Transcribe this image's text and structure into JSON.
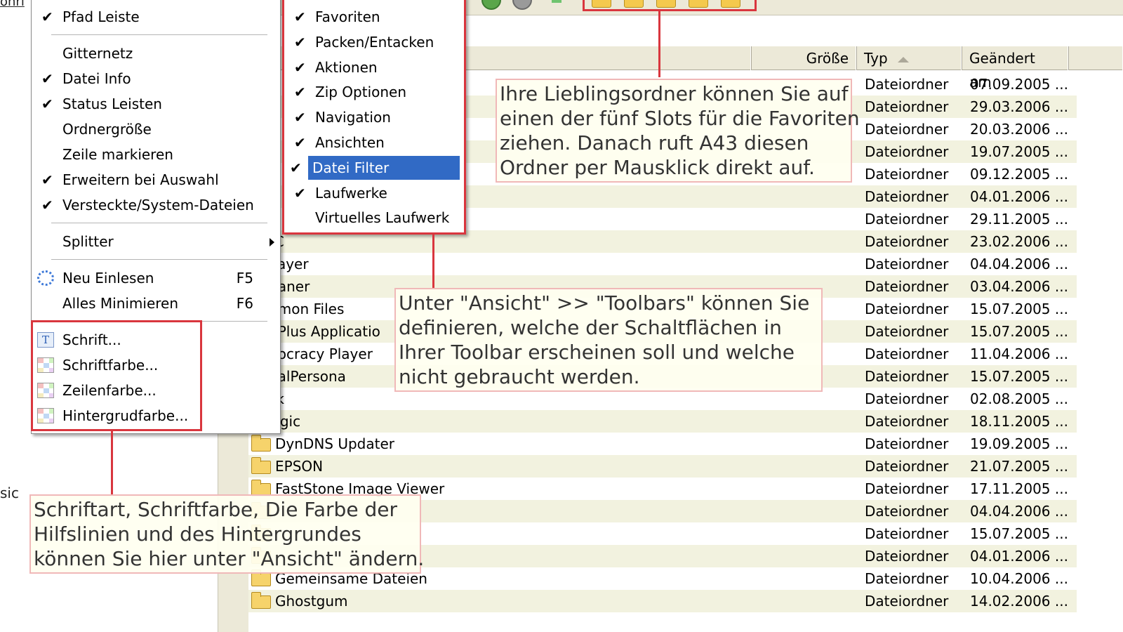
{
  "left_pane": {
    "scrap_top": "onri",
    "scrap_label": "sic"
  },
  "menu_main": {
    "items": [
      {
        "label": "Pfad Leiste",
        "checked": true
      },
      {
        "label": "Gitternetz",
        "checked": false
      },
      {
        "label": "Datei Info",
        "checked": true
      },
      {
        "label": "Status Leisten",
        "checked": true
      },
      {
        "label": "Ordnergröße",
        "checked": false
      },
      {
        "label": "Zeile markieren",
        "checked": false
      },
      {
        "label": "Erweitern bei Auswahl",
        "checked": true
      },
      {
        "label": "Versteckte/System-Dateien",
        "checked": true
      },
      {
        "label": "Splitter",
        "checked": false,
        "submenu": true
      },
      {
        "label": "Neu Einlesen",
        "shortcut": "F5",
        "icon": "refresh-icon"
      },
      {
        "label": "Alles Minimieren",
        "shortcut": "F6"
      },
      {
        "label": "Schrift...",
        "icon": "font-icon"
      },
      {
        "label": "Schriftfarbe...",
        "icon": "color-grid-icon"
      },
      {
        "label": "Zeilenfarbe...",
        "icon": "color-grid-icon"
      },
      {
        "label": "Hintergrudfarbe...",
        "icon": "color-grid-icon"
      }
    ]
  },
  "menu_toolbars": {
    "items": [
      {
        "label": "Favoriten",
        "checked": true
      },
      {
        "label": "Packen/Entacken",
        "checked": true
      },
      {
        "label": "Aktionen",
        "checked": true
      },
      {
        "label": "Zip Optionen",
        "checked": true
      },
      {
        "label": "Navigation",
        "checked": true
      },
      {
        "label": "Ansichten",
        "checked": true
      },
      {
        "label": "Datei Filter",
        "checked": true,
        "highlighted": true
      },
      {
        "label": "Laufwerke",
        "checked": true
      },
      {
        "label": "Virtuelles Laufwerk",
        "checked": false
      }
    ]
  },
  "list": {
    "headers": {
      "size": "Größe",
      "type": "Typ",
      "modified": "Geändert am"
    },
    "rows": [
      {
        "name": "",
        "type": "Dateiordner",
        "date": "07.09.2005 ..."
      },
      {
        "name": "",
        "type": "Dateiordner",
        "date": "29.03.2006 ..."
      },
      {
        "name": "",
        "type": "Dateiordner",
        "date": "20.03.2006 ..."
      },
      {
        "name": "",
        "type": "Dateiordner",
        "date": "19.07.2005 ..."
      },
      {
        "name": "",
        "type": "Dateiordner",
        "date": "09.12.2005 ..."
      },
      {
        "name": "",
        "type": "Dateiordner",
        "date": "04.01.2006 ..."
      },
      {
        "name": "",
        "type": "Dateiordner",
        "date": "29.11.2005 ..."
      },
      {
        "name": "JINC",
        "type": "Dateiordner",
        "date": "23.02.2006 ..."
      },
      {
        "name": "Splayer",
        "type": "Dateiordner",
        "date": "04.04.2006 ..."
      },
      {
        "name": "Cleaner",
        "type": "Dateiordner",
        "date": "03.04.2006 ..."
      },
      {
        "name": "ommon Files",
        "type": "Dateiordner",
        "date": "15.07.2005 ..."
      },
      {
        "name": "omPlus Applicatio",
        "type": "Dateiordner",
        "date": "15.07.2005 ..."
      },
      {
        "name": "emocracy Player",
        "type": "Dateiordner",
        "date": "11.04.2006 ..."
      },
      {
        "name": "igitalPersona",
        "type": "Dateiordner",
        "date": "15.07.2005 ..."
      },
      {
        "name": "Link",
        "type": "Dateiordner",
        "date": "02.08.2005 ..."
      },
      {
        "name": "yLogic",
        "type": "Dateiordner",
        "date": "18.11.2005 ..."
      },
      {
        "name": "DynDNS Updater",
        "type": "Dateiordner",
        "date": "19.09.2005 ...",
        "icon": true
      },
      {
        "name": "EPSON",
        "type": "Dateiordner",
        "date": "21.07.2005 ...",
        "icon": true
      },
      {
        "name": "FastStone Image Viewer",
        "type": "Dateiordner",
        "date": "17.11.2005 ...",
        "icon": true
      },
      {
        "name": "",
        "type": "Dateiordner",
        "date": "04.04.2006 ...",
        "icon": true
      },
      {
        "name": "",
        "type": "Dateiordner",
        "date": "15.07.2005 ...",
        "icon": true
      },
      {
        "name": "",
        "type": "Dateiordner",
        "date": "04.01.2006 ...",
        "icon": true
      },
      {
        "name": "Gemeinsame Dateien",
        "type": "Dateiordner",
        "date": "10.04.2006 ...",
        "icon": true
      },
      {
        "name": "Ghostgum",
        "type": "Dateiordner",
        "date": "14.02.2006 ...",
        "icon": true
      }
    ]
  },
  "callouts": {
    "favorites": [
      "Ihre Lieblingsordner können Sie auf",
      "einen der fünf Slots für die Favoriten",
      "ziehen. Danach ruft A43 diesen",
      "Ordner per Mausklick direkt auf."
    ],
    "toolbars": [
      "Unter \"Ansicht\" >> \"Toolbars\" können Sie",
      "definieren, welche der Schaltflächen in",
      "Ihrer Toolbar erscheinen soll und welche",
      "nicht gebraucht werden."
    ],
    "fonts": [
      "Schriftart, Schriftfarbe, Die Farbe der",
      "Hilfslinien und des Hintergrundes",
      "können Sie hier unter \"Ansicht\" ändern."
    ]
  },
  "colors": {
    "highlight": "#316ac5",
    "annotation_red": "#d9363e",
    "row_alt": "#f2f2df"
  }
}
